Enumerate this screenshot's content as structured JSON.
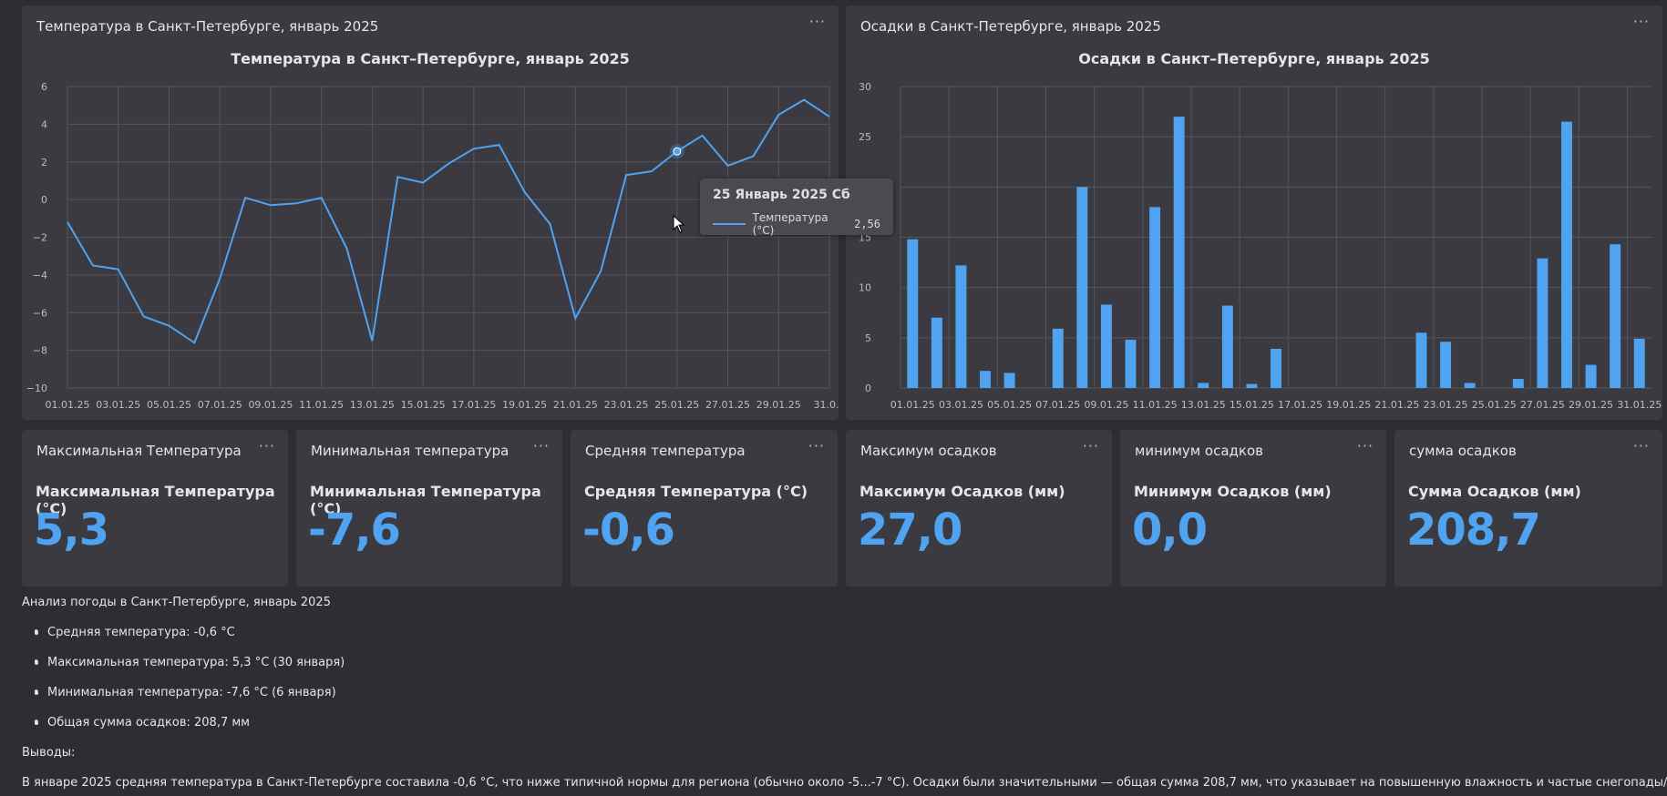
{
  "temp_card": {
    "title": "Температура в Санкт-Петербурге, январь 2025",
    "menu": "···"
  },
  "precip_card": {
    "title": "Осадки в Санкт-Петербурге, январь 2025",
    "menu": "···"
  },
  "tooltip": {
    "date": "25 Январь 2025 Сб",
    "series": "Температура (°C)",
    "value": "2,56"
  },
  "kpis": [
    {
      "title": "Максимальная Температура",
      "subtitle": "Максимальная Температура (°C)",
      "value": "5,3",
      "menu": "···"
    },
    {
      "title": "Минимальная температура",
      "subtitle": "Минимальная Температура (°C)",
      "value": "-7,6",
      "menu": "···"
    },
    {
      "title": "Средняя температура",
      "subtitle": "Средняя Температура (°C)",
      "value": "-0,6",
      "menu": "···"
    },
    {
      "title": "Максимум осадков",
      "subtitle": "Максимум Осадков (мм)",
      "value": "27,0",
      "menu": "···"
    },
    {
      "title": "минимум осадков",
      "subtitle": "Минимум Осадков (мм)",
      "value": "0,0",
      "menu": "···"
    },
    {
      "title": "сумма осадков",
      "subtitle": "Сумма Осадков (мм)",
      "value": "208,7",
      "menu": "···"
    }
  ],
  "notes": {
    "heading": "Анализ погоды в Санкт-Петербурге, январь 2025",
    "items": [
      "Средняя температура: -0,6 °C",
      "Максимальная температура: 5,3 °C (30 января)",
      "Минимальная температура: -7,6 °C (6 января)",
      "Общая сумма осадков: 208,7 мм"
    ],
    "conclusions_label": "Выводы:",
    "conclusion": "В январе 2025 средняя температура в Санкт-Петербурге составила -0,6 °C, что ниже типичной нормы для региона (обычно около -5...-7 °C). Осадки были значительными — общая сумма 208,7 мм, что указывает на повышенную влажность и частые снегопады/дожди."
  },
  "colors": {
    "accent": "#4fa3f0",
    "card": "#3a3a40",
    "background": "#2d2d32"
  },
  "chart_data": [
    {
      "type": "line",
      "title": "Температура в Санкт–Петербурге, январь 2025",
      "xlabel": "",
      "ylabel": "",
      "x": [
        "01.01.25",
        "02.01.25",
        "03.01.25",
        "04.01.25",
        "05.01.25",
        "06.01.25",
        "07.01.25",
        "08.01.25",
        "09.01.25",
        "10.01.25",
        "11.01.25",
        "12.01.25",
        "13.01.25",
        "14.01.25",
        "15.01.25",
        "16.01.25",
        "17.01.25",
        "18.01.25",
        "19.01.25",
        "20.01.25",
        "21.01.25",
        "22.01.25",
        "23.01.25",
        "24.01.25",
        "25.01.25",
        "26.01.25",
        "27.01.25",
        "28.01.25",
        "29.01.25",
        "30.01.25",
        "31.01.25"
      ],
      "x_tick_labels": [
        "01.01.25",
        "03.01.25",
        "05.01.25",
        "07.01.25",
        "09.01.25",
        "11.01.25",
        "13.01.25",
        "15.01.25",
        "17.01.25",
        "19.01.25",
        "21.01.25",
        "23.01.25",
        "25.01.25",
        "27.01.25",
        "29.01.25",
        "31.0..."
      ],
      "series": [
        {
          "name": "Температура (°C)",
          "values": [
            -1.2,
            -3.5,
            -3.7,
            -6.2,
            -6.7,
            -7.6,
            -4.2,
            0.1,
            -0.3,
            -0.2,
            0.1,
            -2.6,
            -7.5,
            1.2,
            0.9,
            1.9,
            2.7,
            2.9,
            0.4,
            -1.3,
            -6.3,
            -3.8,
            1.3,
            1.5,
            2.56,
            3.4,
            1.8,
            2.3,
            4.5,
            5.3,
            4.4
          ]
        }
      ],
      "ylim": [
        -10,
        6
      ],
      "y_ticks": [
        "6",
        "4",
        "2",
        "0",
        "−2",
        "−4",
        "−6",
        "−8",
        "−10"
      ],
      "grid": true,
      "highlight_index": 24
    },
    {
      "type": "bar",
      "title": "Осадки в Санкт–Петербурге, январь 2025",
      "xlabel": "",
      "ylabel": "",
      "categories": [
        "01.01.25",
        "02.01.25",
        "03.01.25",
        "04.01.25",
        "05.01.25",
        "06.01.25",
        "07.01.25",
        "08.01.25",
        "09.01.25",
        "10.01.25",
        "11.01.25",
        "12.01.25",
        "13.01.25",
        "14.01.25",
        "15.01.25",
        "16.01.25",
        "17.01.25",
        "18.01.25",
        "19.01.25",
        "20.01.25",
        "21.01.25",
        "22.01.25",
        "23.01.25",
        "24.01.25",
        "25.01.25",
        "26.01.25",
        "27.01.25",
        "28.01.25",
        "29.01.25",
        "30.01.25",
        "31.01.25"
      ],
      "x_tick_labels": [
        "01.01.25",
        "03.01.25",
        "05.01.25",
        "07.01.25",
        "09.01.25",
        "11.01.25",
        "13.01.25",
        "15.01.25",
        "17.01.25",
        "19.01.25",
        "21.01.25",
        "23.01.25",
        "25.01.25",
        "27.01.25",
        "29.01.25",
        "31.01.25"
      ],
      "values": [
        14.8,
        7.0,
        12.2,
        1.7,
        1.5,
        0,
        5.9,
        20.0,
        8.3,
        4.8,
        18.0,
        27.0,
        0.5,
        8.2,
        0.4,
        3.9,
        0,
        0,
        0,
        0,
        0,
        5.5,
        4.6,
        0.5,
        0,
        0.9,
        12.9,
        26.5,
        2.3,
        14.3,
        4.9
      ],
      "ylim": [
        0,
        30
      ],
      "y_ticks": [
        "30",
        "25",
        "20",
        "15",
        "10",
        "5",
        "0"
      ],
      "grid": true
    }
  ]
}
